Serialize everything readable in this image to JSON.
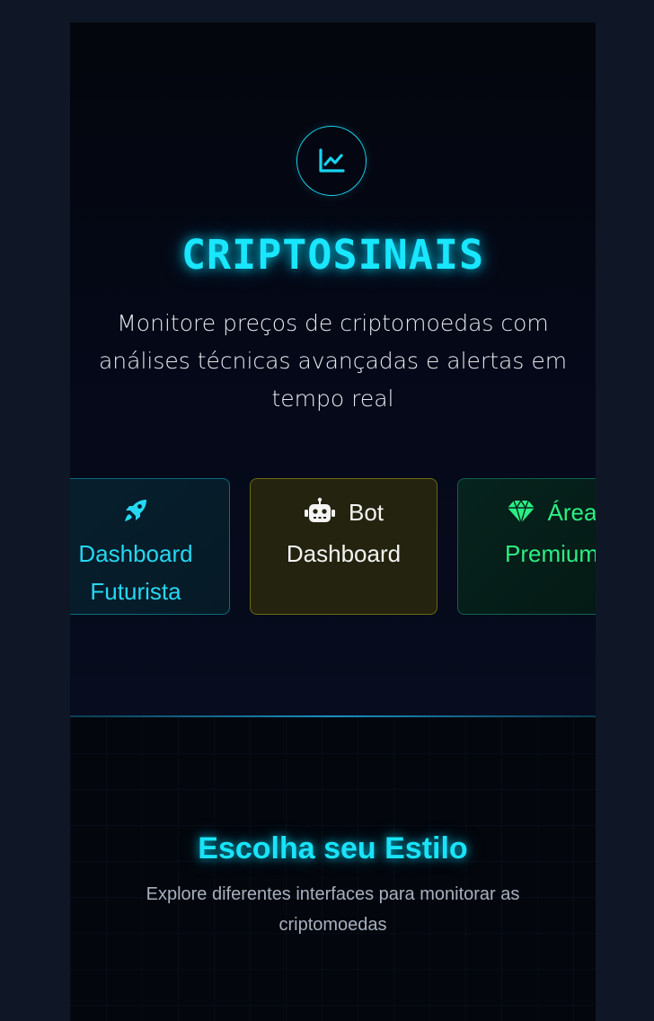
{
  "hero": {
    "icon": "chart-line-icon",
    "title": "CRIPTOSINAIS",
    "subtitle": "Monitore preços de criptomoedas com análises técnicas avançadas e alertas em tempo real"
  },
  "tabs": [
    {
      "icon": "rocket-icon",
      "line1": "Dashboard",
      "line2": "Futurista",
      "color": "#25d7f2"
    },
    {
      "icon": "robot-icon",
      "line1": "Bot",
      "line2": "Dashboard",
      "color": "#f4f4f4"
    },
    {
      "icon": "gem-icon",
      "line1": "Área",
      "line2": "Premium",
      "color": "#2bef83"
    }
  ],
  "section": {
    "title": "Escolha seu Estilo",
    "subtitle": "Explore diferentes interfaces para monitorar as criptomoedas"
  },
  "colors": {
    "accent": "#19e6ff",
    "background": "#04070e",
    "outer": "#0f1726"
  }
}
